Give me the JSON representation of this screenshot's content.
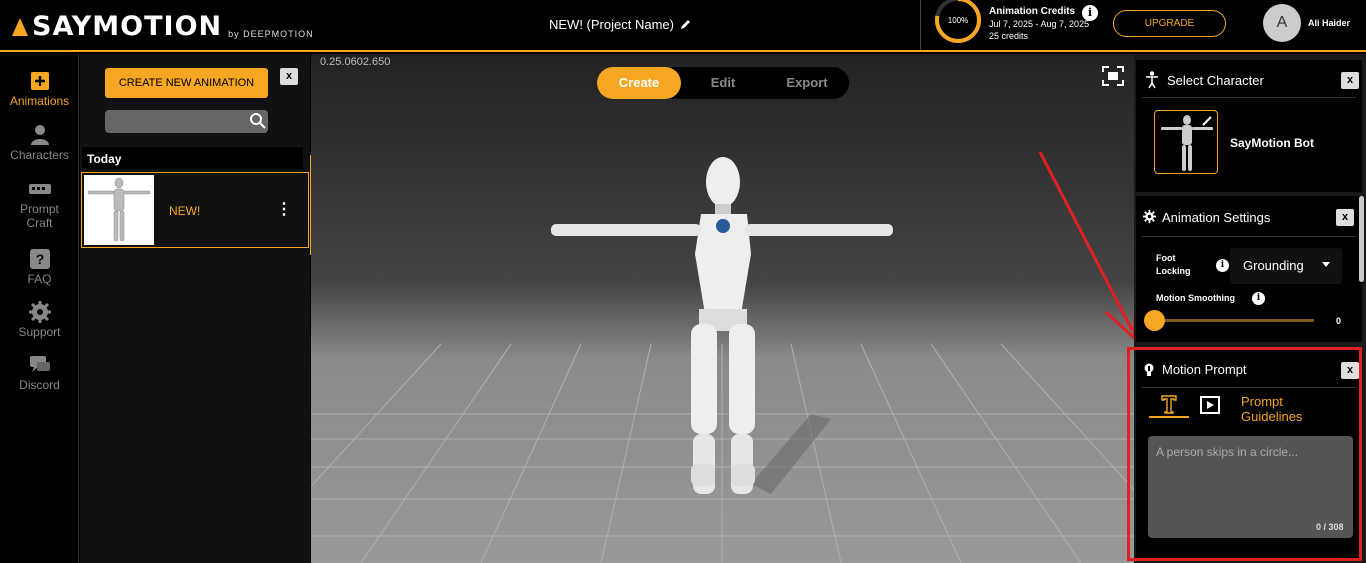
{
  "header": {
    "logo_text": "SAYMOTION",
    "logo_by": "by DEEPMOTION",
    "project_name": "NEW! (Project Name)",
    "credits_percent": "100%",
    "credits_fraction": 1.0,
    "credits_title": "Animation Credits",
    "credits_period": "Jul 7, 2025 - Aug 7, 2025",
    "credits_amount": "25 credits",
    "upgrade_label": "UPGRADE",
    "avatar_initial": "A",
    "user_name": "Ali Haider"
  },
  "nav": {
    "items": [
      {
        "label": "Animations",
        "icon": "plus-icon",
        "active": true
      },
      {
        "label": "Characters",
        "icon": "person-icon"
      },
      {
        "label": "Prompt Craft",
        "icon": "keyboard-icon"
      },
      {
        "label": "FAQ",
        "icon": "question-icon"
      },
      {
        "label": "Support",
        "icon": "gear-icon"
      },
      {
        "label": "Discord",
        "icon": "chat-icon"
      }
    ]
  },
  "animations_panel": {
    "create_label": "CREATE NEW ANIMATION",
    "close_label": "x",
    "search_placeholder": "",
    "section_label": "Today",
    "items": [
      {
        "name": "NEW!"
      }
    ],
    "menu_glyph": "⋮"
  },
  "viewport": {
    "version": "0.25.0602.650",
    "tabs": [
      "Create",
      "Edit",
      "Export"
    ],
    "active_tab": "Create"
  },
  "select_character": {
    "title": "Select Character",
    "close_label": "x",
    "character_name": "SayMotion Bot"
  },
  "animation_settings": {
    "title": "Animation Settings",
    "close_label": "x",
    "foot_locking_label": "Foot Locking",
    "foot_locking_value": "Grounding",
    "motion_smoothing_label": "Motion Smoothing",
    "motion_smoothing_value": "0"
  },
  "motion_prompt": {
    "title": "Motion Prompt",
    "close_label": "x",
    "guidelines_label": "Prompt Guidelines",
    "placeholder": "A person skips in a circle...",
    "value": "",
    "count": "0 / 308"
  },
  "colors": {
    "accent": "#f5a623",
    "highlight": "#e02020",
    "background": "#000000"
  }
}
